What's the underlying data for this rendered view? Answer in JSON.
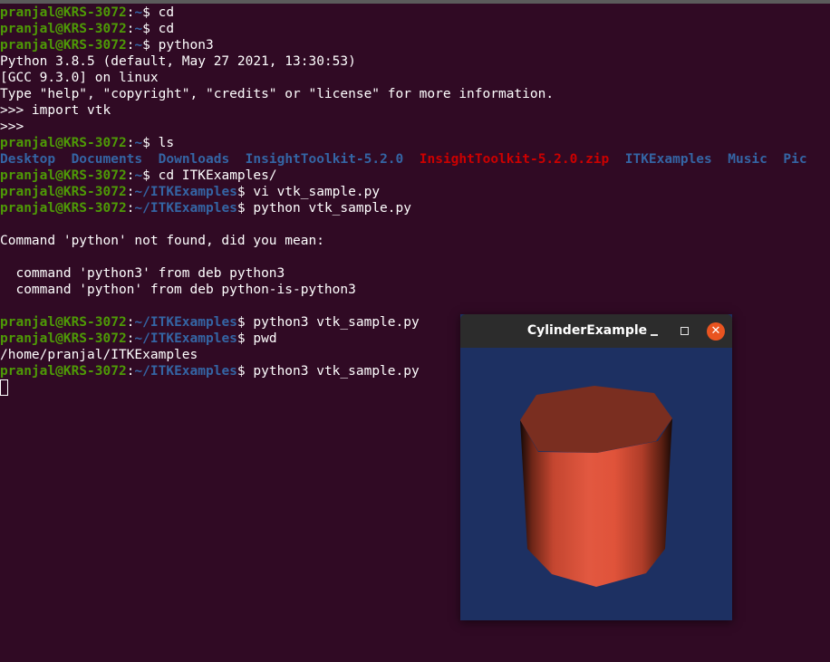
{
  "prompt": {
    "user": "pranjal@KRS-3072",
    "sep": ":",
    "home": "~",
    "itk": "~/ITKExamples",
    "dollar": "$"
  },
  "terminal": {
    "cmd_cd1": " cd",
    "cmd_cd2": " cd",
    "cmd_python3": " python3",
    "py_version": "Python 3.8.5 (default, May 27 2021, 13:30:53)",
    "gcc_line": "[GCC 9.3.0] on linux",
    "help_line": "Type \"help\", \"copyright\", \"credits\" or \"license\" for more information.",
    "import_line": ">>> import vtk",
    "repl_prompt": ">>>",
    "cmd_ls": " ls",
    "ls_entries": [
      {
        "name": "Desktop",
        "type": "dir"
      },
      {
        "name": "Documents",
        "type": "dir"
      },
      {
        "name": "Downloads",
        "type": "dir"
      },
      {
        "name": "InsightToolkit-5.2.0",
        "type": "dir"
      },
      {
        "name": "InsightToolkit-5.2.0.zip",
        "type": "zip"
      },
      {
        "name": "ITKExamples",
        "type": "dir"
      },
      {
        "name": "Music",
        "type": "dir"
      },
      {
        "name": "Pic",
        "type": "dir"
      }
    ],
    "cmd_cd_itk": " cd ITKExamples/",
    "cmd_vi": " vi vtk_sample.py",
    "cmd_python": " python vtk_sample.py",
    "not_found": "Command 'python' not found, did you mean:",
    "suggest1": "  command 'python3' from deb python3",
    "suggest2": "  command 'python' from deb python-is-python3",
    "cmd_run1": " python3 vtk_sample.py",
    "cmd_pwd": " pwd",
    "pwd_output": "/home/pranjal/ITKExamples",
    "cmd_run2": " python3 vtk_sample.py"
  },
  "vtk_window": {
    "title": "CylinderExample",
    "close_glyph": "✕",
    "background_color": "#1d3062",
    "cylinder_color": "#e0533a"
  }
}
